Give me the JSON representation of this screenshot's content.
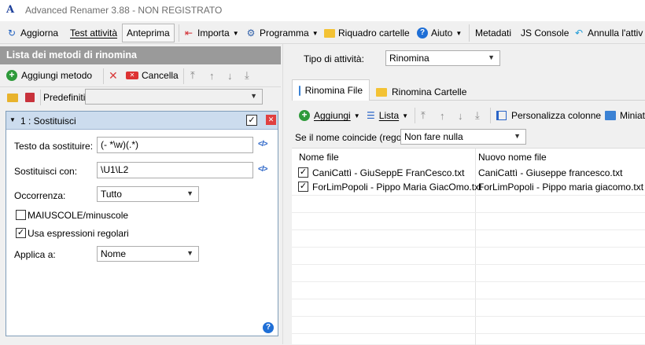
{
  "window": {
    "title": "Advanced Renamer 3.88 - NON REGISTRATO"
  },
  "toolbar": {
    "refresh": "Aggiorna",
    "test_batch": "Test attività",
    "preview": "Anteprima",
    "import": "Importa",
    "schedule": "Programma",
    "folder_pane": "Riquadro cartelle",
    "help": "Aiuto",
    "metadata": "Metadati",
    "js_console": "JS Console",
    "undo": "Annulla l'attiv"
  },
  "methods_panel": {
    "title": "Lista dei metodi di rinomina",
    "add_method": "Aggiungi metodo",
    "cancel": "Cancella",
    "presets_label": "Predefiniti:",
    "presets_value": ""
  },
  "method": {
    "title": "1 : Sostituisci",
    "enabled": true,
    "text_to_replace_label": "Testo da sostituire:",
    "text_to_replace_value": "(- *\\w)(.*)",
    "replace_with_label": "Sostituisci con:",
    "replace_with_value": "\\U1\\L2",
    "occurrence_label": "Occorrenza:",
    "occurrence_value": "Tutto",
    "case_sensitive_label": "MAIUSCOLE/minuscole",
    "case_sensitive_checked": false,
    "use_regex_label": "Usa espressioni regolari",
    "use_regex_checked": true,
    "apply_to_label": "Applica a:",
    "apply_to_value": "Nome",
    "regex_icon": "</>"
  },
  "task": {
    "label": "Tipo di attività:",
    "value": "Rinomina"
  },
  "tabs": [
    {
      "label": "Rinomina File",
      "active": true
    },
    {
      "label": "Rinomina Cartelle",
      "active": false
    }
  ],
  "files_toolbar": {
    "add": "Aggiungi",
    "list": "Lista",
    "customize_columns": "Personalizza colonne",
    "thumbnails": "Miniat"
  },
  "collision": {
    "label": "Se il nome coincide (regola):",
    "value": "Non fare nulla"
  },
  "grid": {
    "col_filename": "Nome file",
    "col_new_filename": "Nuovo nome file",
    "rows": [
      {
        "checked": true,
        "filename": "CaniCattì - GiuSeppE FranCesco.txt",
        "new_filename": "CaniCattì - Giuseppe francesco.txt"
      },
      {
        "checked": true,
        "filename": "ForLimPopoli - Pippo Maria GiacOmo.txt",
        "new_filename": "ForLimPopoli - Pippo maria giacomo.txt"
      }
    ]
  },
  "colors": {
    "accent": "#0a63c9",
    "panel_header": "#9a9a9a",
    "card_header": "#ccdcee",
    "close_red": "#e04040"
  }
}
